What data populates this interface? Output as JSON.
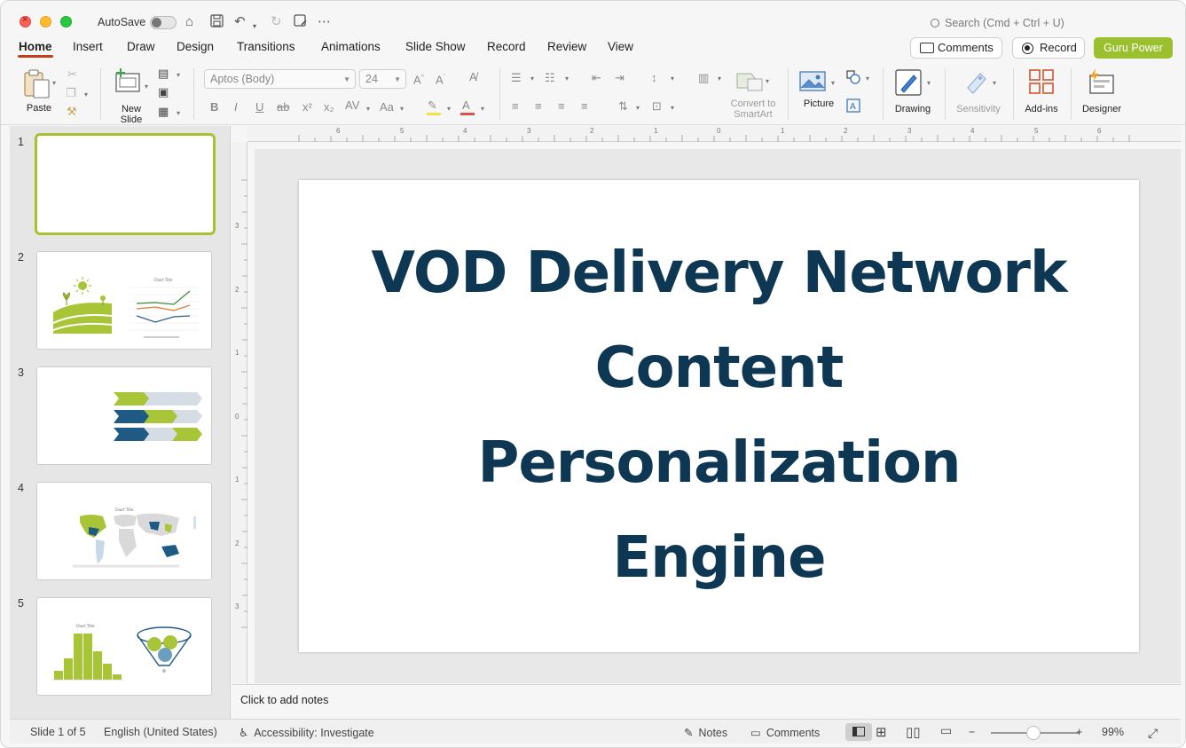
{
  "window": {
    "autosave_label": "AutoSave",
    "search_placeholder": "Search (Cmd + Ctrl + U)"
  },
  "menu": {
    "tabs": [
      "Home",
      "Insert",
      "Draw",
      "Design",
      "Transitions",
      "Animations",
      "Slide Show",
      "Record",
      "Review",
      "View"
    ],
    "active": "Home",
    "comments_label": "Comments",
    "record_label": "Record",
    "guru_label": "Guru Power"
  },
  "ribbon": {
    "paste": "Paste",
    "new_slide_1": "New",
    "new_slide_2": "Slide",
    "font_name": "Aptos (Body)",
    "font_size": "24",
    "convert_1": "Convert to",
    "convert_2": "SmartArt",
    "picture": "Picture",
    "drawing": "Drawing",
    "sensitivity": "Sensitivity",
    "addins": "Add-ins",
    "designer": "Designer"
  },
  "thumbnails": {
    "numbers": [
      "1",
      "2",
      "3",
      "4",
      "5"
    ],
    "chart_title": "Chart Title"
  },
  "slide": {
    "title_lines": [
      "VOD Delivery Network",
      "Content",
      "Personalization",
      "Engine"
    ]
  },
  "notes": {
    "placeholder": "Click to add notes"
  },
  "status": {
    "slide_pos": "Slide 1 of 5",
    "language": "English (United States)",
    "accessibility": "Accessibility: Investigate",
    "notes": "Notes",
    "comments": "Comments",
    "zoom": "99%"
  },
  "colors": {
    "accent_green": "#9bc02f",
    "title_navy": "#0d3752",
    "active_tab_underline": "#c43e1c"
  }
}
